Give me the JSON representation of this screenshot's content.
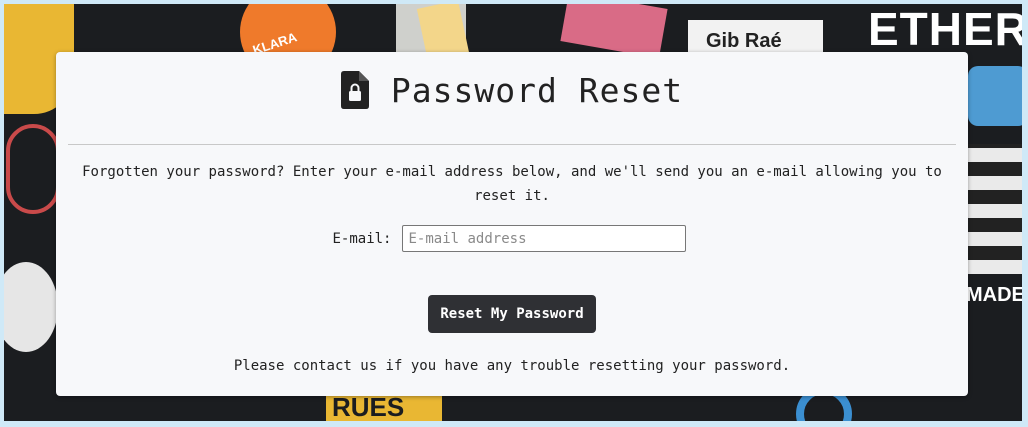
{
  "page": {
    "title": "Password Reset",
    "title_icon": "file-lock-icon",
    "description": "Forgotten your password? Enter your e-mail address below, and we'll send you an e-mail allowing you to reset it.",
    "email_label": "E-mail:",
    "email_placeholder": "E-mail address",
    "email_value": "",
    "submit_label": "Reset My Password",
    "contact_text": "Please contact us if you have any trouble resetting your password."
  },
  "background": {
    "sticker_texts": [
      "ETHER",
      "Gib Raé",
      "KLARA",
      "MADE",
      "RUES"
    ]
  },
  "colors": {
    "page_border": "#cfe9f7",
    "card_bg": "#f7f8fa",
    "button_bg": "#2f3034",
    "button_text": "#ffffff",
    "text": "#222222"
  }
}
